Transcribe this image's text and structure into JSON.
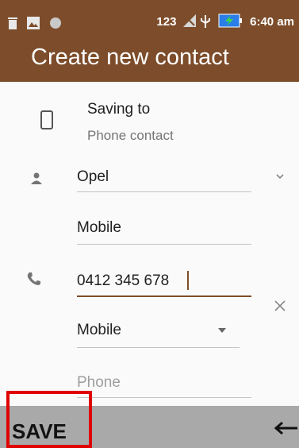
{
  "status_bar": {
    "left_icons": [
      "trash-icon",
      "image-icon",
      "circle-icon"
    ],
    "network_text": "123",
    "right_icons": [
      "no-signal-icon",
      "usb-icon",
      "battery-charging-icon"
    ],
    "time": "6:40 am"
  },
  "app_bar": {
    "title": "Create new contact"
  },
  "form": {
    "saving_to_label": "Saving to",
    "saving_to_value": "Phone contact",
    "name_value": "Opel",
    "company_value": "Mobile",
    "phone_value": "0412 345 678",
    "phone_type_value": "Mobile",
    "new_phone_placeholder": "Phone"
  },
  "bottom_bar": {
    "save_label": "SAVE",
    "back_icon": "arrow-left-icon"
  },
  "colors": {
    "primary": "#7d4d2b",
    "highlight_border": "#e00000",
    "bottom_bar": "#a9a9a9"
  }
}
